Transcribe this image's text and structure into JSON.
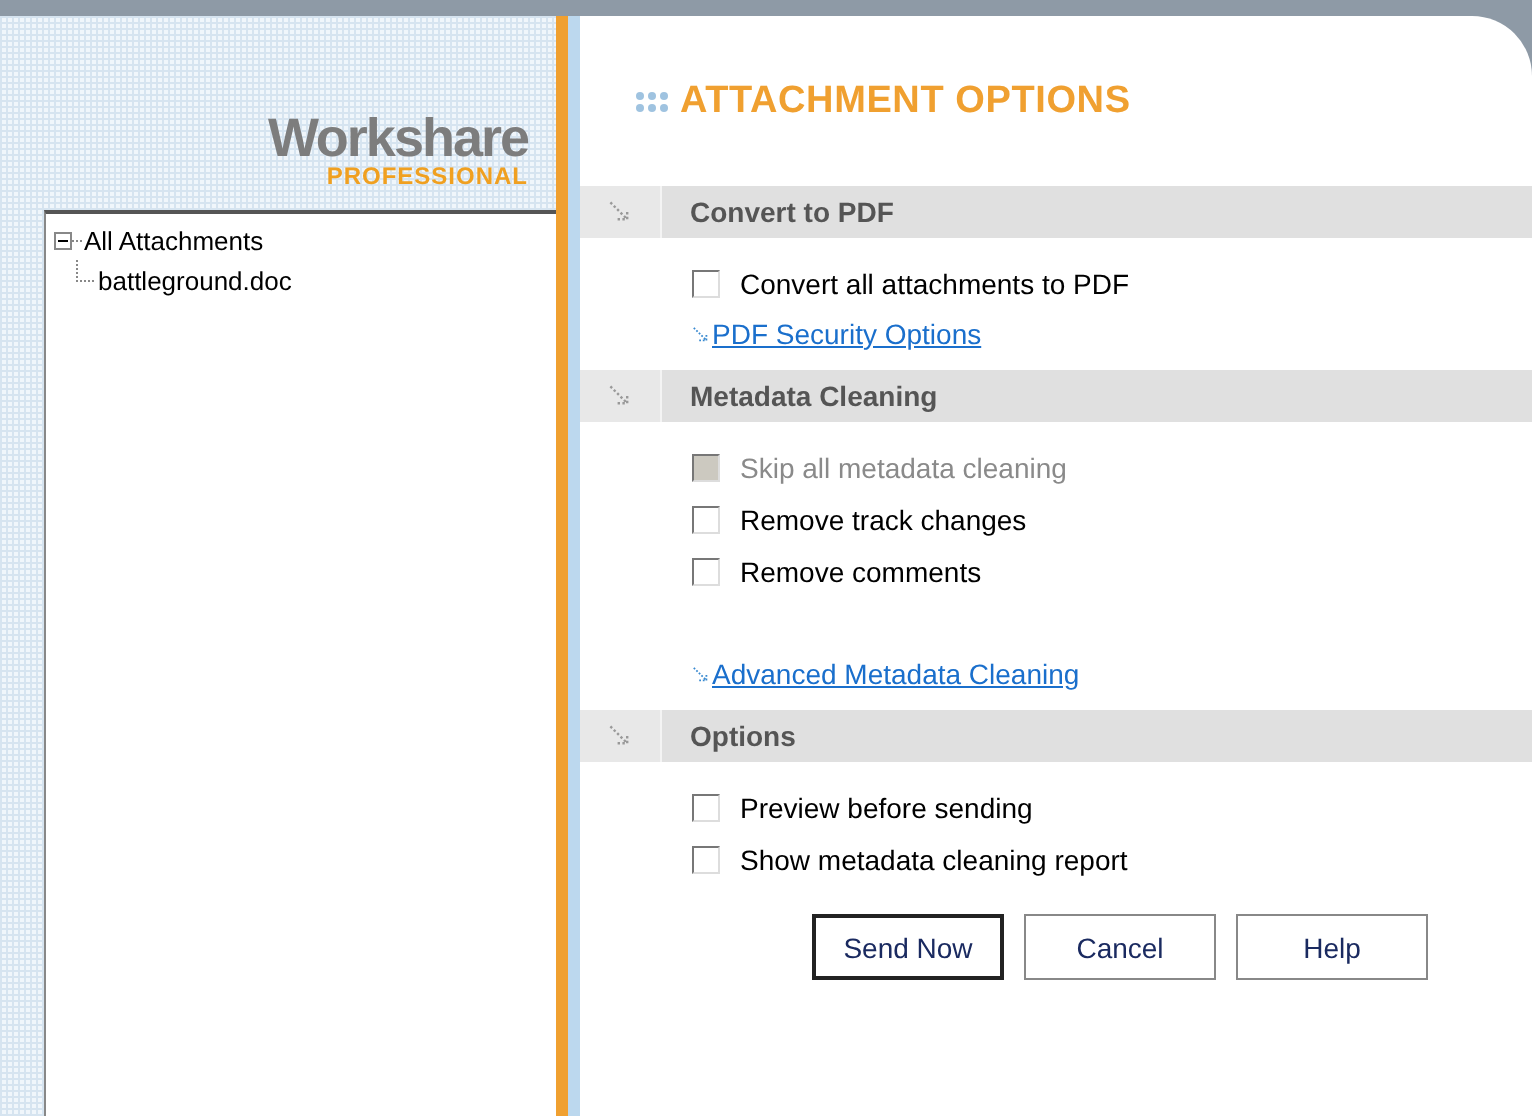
{
  "logo": {
    "name": "Workshare",
    "edition": "PROFESSIONAL"
  },
  "tree": [
    {
      "label": "All Attachments",
      "expanded": true,
      "children": [
        {
          "label": "battleground.doc"
        }
      ]
    }
  ],
  "title": "ATTACHMENT OPTIONS",
  "sections": [
    {
      "title": "Convert to PDF",
      "items": [
        {
          "kind": "checkbox",
          "label": "Convert all attachments to PDF",
          "checked": false,
          "disabled": false
        },
        {
          "kind": "link",
          "label": "PDF Security Options"
        }
      ]
    },
    {
      "title": "Metadata Cleaning",
      "items": [
        {
          "kind": "checkbox",
          "label": "Skip all metadata cleaning",
          "checked": false,
          "disabled": true
        },
        {
          "kind": "checkbox",
          "label": "Remove track changes",
          "checked": false,
          "disabled": false
        },
        {
          "kind": "checkbox",
          "label": "Remove comments",
          "checked": false,
          "disabled": false
        },
        {
          "kind": "link",
          "label": "Advanced Metadata Cleaning"
        }
      ]
    },
    {
      "title": "Options",
      "items": [
        {
          "kind": "checkbox",
          "label": "Preview before sending",
          "checked": false,
          "disabled": false
        },
        {
          "kind": "checkbox",
          "label": "Show metadata cleaning report",
          "checked": false,
          "disabled": false
        }
      ]
    }
  ],
  "buttons": [
    {
      "label": "Send Now",
      "default": true
    },
    {
      "label": "Cancel",
      "default": false
    },
    {
      "label": "Help",
      "default": false
    }
  ]
}
